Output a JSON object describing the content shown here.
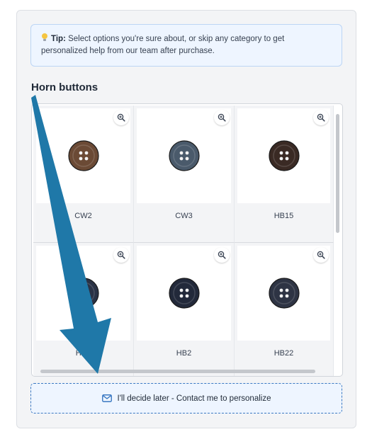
{
  "tip": {
    "icon": "lightbulb-icon",
    "label": "Tip:",
    "text": "Select options you're sure about, or skip any category to get personalized help from our team after purchase."
  },
  "section": {
    "title": "Horn buttons"
  },
  "buttons": [
    {
      "code": "CW2",
      "color": "#6b4a35"
    },
    {
      "code": "CW3",
      "color": "#4a5a6b"
    },
    {
      "code": "HB15",
      "color": "#3a2a24"
    },
    {
      "code": "HB1",
      "color": "#2a3245"
    },
    {
      "code": "HB2",
      "color": "#22293a"
    },
    {
      "code": "HB22",
      "color": "#2e3444"
    }
  ],
  "contact": {
    "icon": "mail-icon",
    "label": "I'll decide later - Contact me to personalize"
  },
  "colors": {
    "accent": "#3a78c2",
    "annotation_arrow": "#1f78a8"
  }
}
